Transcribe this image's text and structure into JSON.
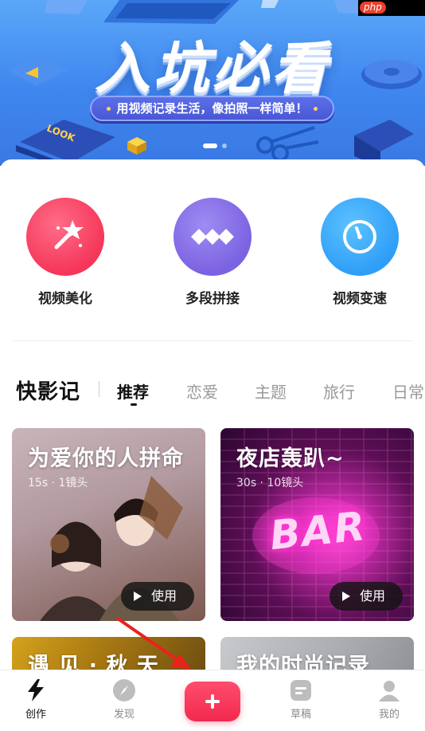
{
  "banner": {
    "title": "入坑必看",
    "slogan": "用视频记录生活，像拍照一样简单！",
    "deco_text": "LOOK",
    "watermark": "php",
    "active_slide": 1,
    "slide_count": 2
  },
  "tools": [
    {
      "label": "视频美化",
      "icon": "magic-wand-icon",
      "color": "#f5365a"
    },
    {
      "label": "多段拼接",
      "icon": "diamonds-icon",
      "color": "#7b62e2"
    },
    {
      "label": "视频变速",
      "icon": "speedometer-icon",
      "color": "#2f9ef7"
    }
  ],
  "category_bar": {
    "brand": "快影记",
    "tabs": [
      "推荐",
      "恋爱",
      "主题",
      "旅行",
      "日常"
    ],
    "active_tab": "推荐"
  },
  "cards": [
    {
      "title": "为爱你的人拼命",
      "meta": "15s · 1镜头",
      "button": "使用"
    },
    {
      "title": "夜店轰趴~",
      "meta": "30s · 10镜头",
      "button": "使用",
      "sign_text": "BAR"
    },
    {
      "title": "遇 见 · 秋 天"
    },
    {
      "title": "我的时尚记录"
    }
  ],
  "bottom_nav": {
    "items": [
      {
        "label": "创作",
        "icon": "lightning-icon",
        "active": true
      },
      {
        "label": "发现",
        "icon": "compass-icon",
        "active": false
      },
      {
        "label": "草稿",
        "icon": "draft-icon",
        "active": false
      },
      {
        "label": "我的",
        "icon": "user-icon",
        "active": false
      }
    ],
    "add_icon": "plus-icon"
  },
  "colors": {
    "accent": "#f2294f",
    "banner_blue": "#3f86ef",
    "arrow_red": "#e8231b"
  }
}
